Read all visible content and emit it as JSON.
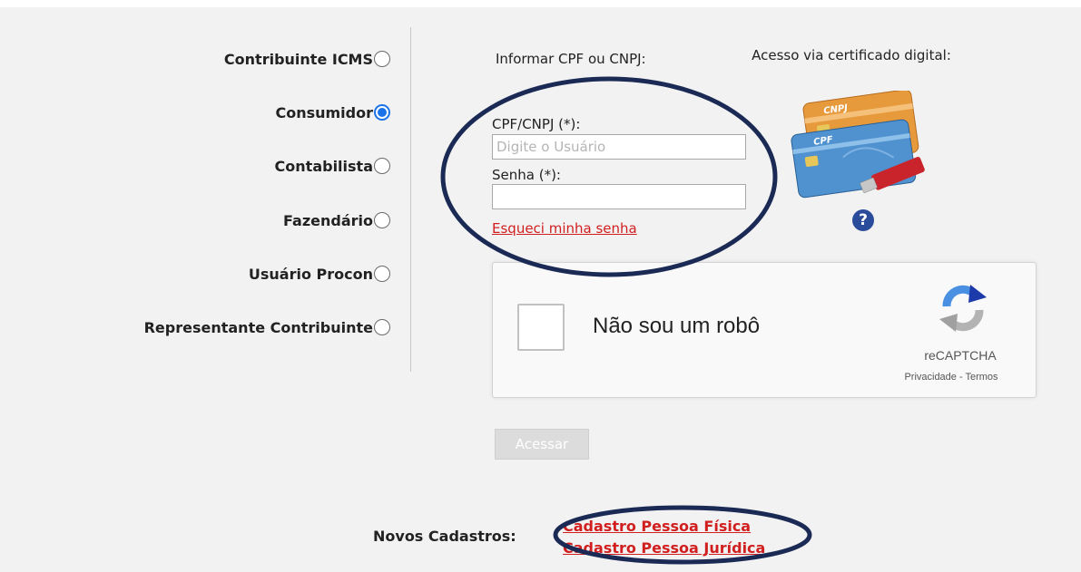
{
  "user_types": [
    {
      "label": "Contribuinte ICMS",
      "checked": false
    },
    {
      "label": "Consumidor",
      "checked": true
    },
    {
      "label": "Contabilista",
      "checked": false
    },
    {
      "label": "Fazendário",
      "checked": false
    },
    {
      "label": "Usuário Procon",
      "checked": false
    },
    {
      "label": "Representante Contribuinte",
      "checked": false
    }
  ],
  "login": {
    "prompt": "Informar CPF ou CNPJ:",
    "cpf_label": "CPF/CNPJ (*):",
    "cpf_placeholder": "Digite o Usuário",
    "cpf_value": "",
    "password_label": "Senha (*):",
    "password_value": "",
    "forgot_link": "Esqueci minha senha"
  },
  "certificate": {
    "title": "Acesso via certificado digital:",
    "card_brand_top": "CNPJ",
    "card_brand_bottom": "CPF",
    "help_icon": "question-circle-icon"
  },
  "captcha": {
    "label": "Não sou um robô",
    "brand": "reCAPTCHA",
    "terms": "Privacidade - Termos"
  },
  "submit_label": "Acessar",
  "registration": {
    "label": "Novos Cadastros:",
    "links": [
      "Cadastro Pessoa Física",
      "Cadastro Pessoa Jurídica"
    ]
  },
  "colors": {
    "background": "#f2f2f2",
    "link_red": "#d11f1f",
    "radio_selected": "#1a73e8",
    "annotation_ellipse": "#1b2a55",
    "button_disabled": "#dcdcdc"
  }
}
